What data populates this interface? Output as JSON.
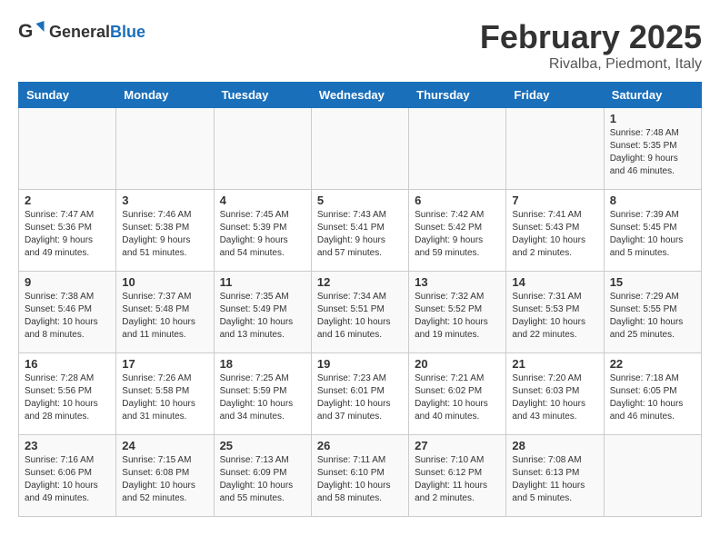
{
  "header": {
    "logo_general": "General",
    "logo_blue": "Blue",
    "title": "February 2025",
    "subtitle": "Rivalba, Piedmont, Italy"
  },
  "days_of_week": [
    "Sunday",
    "Monday",
    "Tuesday",
    "Wednesday",
    "Thursday",
    "Friday",
    "Saturday"
  ],
  "weeks": [
    [
      {
        "day": "",
        "info": ""
      },
      {
        "day": "",
        "info": ""
      },
      {
        "day": "",
        "info": ""
      },
      {
        "day": "",
        "info": ""
      },
      {
        "day": "",
        "info": ""
      },
      {
        "day": "",
        "info": ""
      },
      {
        "day": "1",
        "info": "Sunrise: 7:48 AM\nSunset: 5:35 PM\nDaylight: 9 hours and 46 minutes."
      }
    ],
    [
      {
        "day": "2",
        "info": "Sunrise: 7:47 AM\nSunset: 5:36 PM\nDaylight: 9 hours and 49 minutes."
      },
      {
        "day": "3",
        "info": "Sunrise: 7:46 AM\nSunset: 5:38 PM\nDaylight: 9 hours and 51 minutes."
      },
      {
        "day": "4",
        "info": "Sunrise: 7:45 AM\nSunset: 5:39 PM\nDaylight: 9 hours and 54 minutes."
      },
      {
        "day": "5",
        "info": "Sunrise: 7:43 AM\nSunset: 5:41 PM\nDaylight: 9 hours and 57 minutes."
      },
      {
        "day": "6",
        "info": "Sunrise: 7:42 AM\nSunset: 5:42 PM\nDaylight: 9 hours and 59 minutes."
      },
      {
        "day": "7",
        "info": "Sunrise: 7:41 AM\nSunset: 5:43 PM\nDaylight: 10 hours and 2 minutes."
      },
      {
        "day": "8",
        "info": "Sunrise: 7:39 AM\nSunset: 5:45 PM\nDaylight: 10 hours and 5 minutes."
      }
    ],
    [
      {
        "day": "9",
        "info": "Sunrise: 7:38 AM\nSunset: 5:46 PM\nDaylight: 10 hours and 8 minutes."
      },
      {
        "day": "10",
        "info": "Sunrise: 7:37 AM\nSunset: 5:48 PM\nDaylight: 10 hours and 11 minutes."
      },
      {
        "day": "11",
        "info": "Sunrise: 7:35 AM\nSunset: 5:49 PM\nDaylight: 10 hours and 13 minutes."
      },
      {
        "day": "12",
        "info": "Sunrise: 7:34 AM\nSunset: 5:51 PM\nDaylight: 10 hours and 16 minutes."
      },
      {
        "day": "13",
        "info": "Sunrise: 7:32 AM\nSunset: 5:52 PM\nDaylight: 10 hours and 19 minutes."
      },
      {
        "day": "14",
        "info": "Sunrise: 7:31 AM\nSunset: 5:53 PM\nDaylight: 10 hours and 22 minutes."
      },
      {
        "day": "15",
        "info": "Sunrise: 7:29 AM\nSunset: 5:55 PM\nDaylight: 10 hours and 25 minutes."
      }
    ],
    [
      {
        "day": "16",
        "info": "Sunrise: 7:28 AM\nSunset: 5:56 PM\nDaylight: 10 hours and 28 minutes."
      },
      {
        "day": "17",
        "info": "Sunrise: 7:26 AM\nSunset: 5:58 PM\nDaylight: 10 hours and 31 minutes."
      },
      {
        "day": "18",
        "info": "Sunrise: 7:25 AM\nSunset: 5:59 PM\nDaylight: 10 hours and 34 minutes."
      },
      {
        "day": "19",
        "info": "Sunrise: 7:23 AM\nSunset: 6:01 PM\nDaylight: 10 hours and 37 minutes."
      },
      {
        "day": "20",
        "info": "Sunrise: 7:21 AM\nSunset: 6:02 PM\nDaylight: 10 hours and 40 minutes."
      },
      {
        "day": "21",
        "info": "Sunrise: 7:20 AM\nSunset: 6:03 PM\nDaylight: 10 hours and 43 minutes."
      },
      {
        "day": "22",
        "info": "Sunrise: 7:18 AM\nSunset: 6:05 PM\nDaylight: 10 hours and 46 minutes."
      }
    ],
    [
      {
        "day": "23",
        "info": "Sunrise: 7:16 AM\nSunset: 6:06 PM\nDaylight: 10 hours and 49 minutes."
      },
      {
        "day": "24",
        "info": "Sunrise: 7:15 AM\nSunset: 6:08 PM\nDaylight: 10 hours and 52 minutes."
      },
      {
        "day": "25",
        "info": "Sunrise: 7:13 AM\nSunset: 6:09 PM\nDaylight: 10 hours and 55 minutes."
      },
      {
        "day": "26",
        "info": "Sunrise: 7:11 AM\nSunset: 6:10 PM\nDaylight: 10 hours and 58 minutes."
      },
      {
        "day": "27",
        "info": "Sunrise: 7:10 AM\nSunset: 6:12 PM\nDaylight: 11 hours and 2 minutes."
      },
      {
        "day": "28",
        "info": "Sunrise: 7:08 AM\nSunset: 6:13 PM\nDaylight: 11 hours and 5 minutes."
      },
      {
        "day": "",
        "info": ""
      }
    ]
  ]
}
